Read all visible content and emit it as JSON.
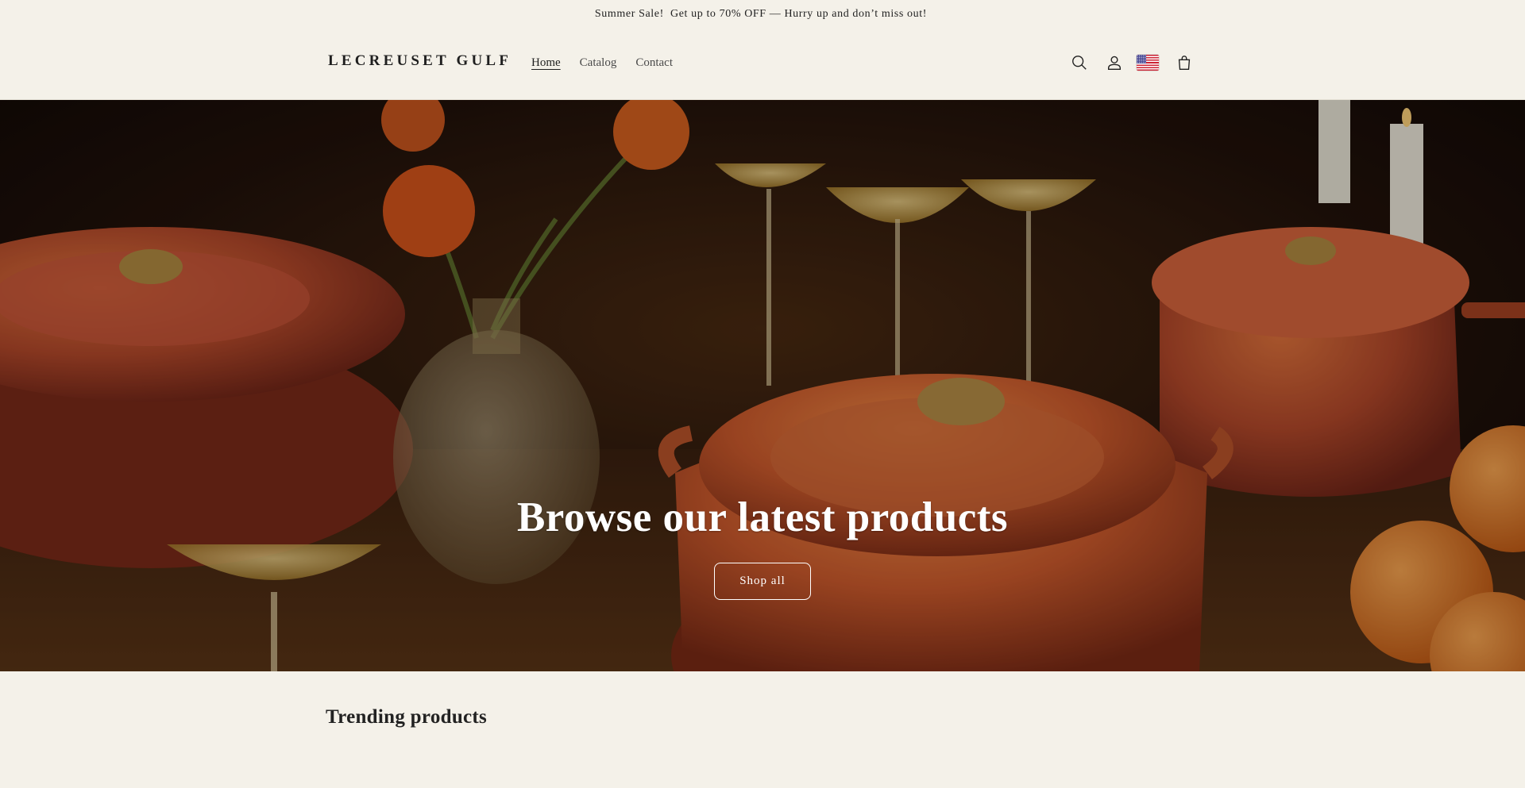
{
  "announcement": {
    "text": "Summer Sale! ⁣ Get up to 70% OFF — Hurry up and don’t miss out! ⁣⁣"
  },
  "header": {
    "logo": "LECREUSET GULF",
    "nav": [
      {
        "label": "Home",
        "active": true
      },
      {
        "label": "Catalog",
        "active": false
      },
      {
        "label": "Contact",
        "active": false
      }
    ],
    "icons": [
      "search-icon",
      "account-icon",
      "us-flag-icon",
      "cart-icon"
    ]
  },
  "hero": {
    "title": "Browse our latest products",
    "button_label": "Shop all"
  },
  "trending": {
    "title": "Trending products"
  },
  "colors": {
    "background": "#f4f1e9",
    "text": "#1f1f1f",
    "pot_orange": "#c8582c",
    "hero_button_border": "#ffffff"
  }
}
